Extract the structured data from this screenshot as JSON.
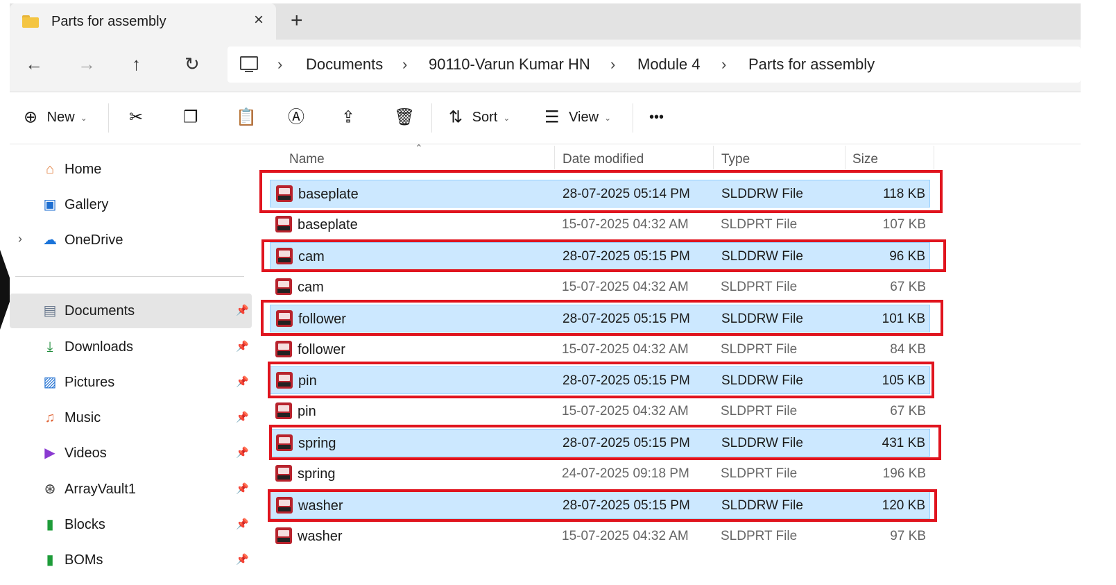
{
  "tab": {
    "title": "Parts for assembly",
    "close": "×",
    "new_tab": "+"
  },
  "nav": {
    "back": "←",
    "forward": "→",
    "up": "↑",
    "refresh": "↻",
    "breadcrumbs": [
      "Documents",
      "90110-Varun Kumar HN",
      "Module 4",
      "Parts for assembly"
    ],
    "separator": "›"
  },
  "toolbar": {
    "new_label": "New",
    "sort_label": "Sort",
    "view_label": "View",
    "more_label": "•••",
    "icons": [
      "cut-icon",
      "copy-icon",
      "paste-icon",
      "rename-icon",
      "share-icon",
      "delete-icon"
    ]
  },
  "sidebar": {
    "items": [
      {
        "label": "Home",
        "icon": "home-icon"
      },
      {
        "label": "Gallery",
        "icon": "gallery-icon"
      },
      {
        "label": "OneDrive",
        "icon": "cloud-icon"
      },
      {
        "label": "Documents",
        "icon": "documents-icon",
        "pinned": true,
        "active": true
      },
      {
        "label": "Downloads",
        "icon": "download-icon",
        "pinned": true
      },
      {
        "label": "Pictures",
        "icon": "pictures-icon",
        "pinned": true
      },
      {
        "label": "Music",
        "icon": "music-icon",
        "pinned": true
      },
      {
        "label": "Videos",
        "icon": "videos-icon",
        "pinned": true
      },
      {
        "label": "ArrayVault1",
        "icon": "network-icon",
        "pinned": true
      },
      {
        "label": "Blocks",
        "icon": "book-icon",
        "pinned": true
      },
      {
        "label": "BOMs",
        "icon": "book-icon",
        "pinned": true
      }
    ]
  },
  "columns": {
    "name": "Name",
    "date": "Date modified",
    "type": "Type",
    "size": "Size"
  },
  "files": [
    {
      "name": "baseplate",
      "date": "28-07-2025 05:14 PM",
      "type": "SLDDRW File",
      "size": "118 KB",
      "selected": true
    },
    {
      "name": "baseplate",
      "date": "15-07-2025 04:32 AM",
      "type": "SLDPRT File",
      "size": "107 KB",
      "selected": false
    },
    {
      "name": "cam",
      "date": "28-07-2025 05:15 PM",
      "type": "SLDDRW File",
      "size": "96 KB",
      "selected": true
    },
    {
      "name": "cam",
      "date": "15-07-2025 04:32 AM",
      "type": "SLDPRT File",
      "size": "67 KB",
      "selected": false
    },
    {
      "name": "follower",
      "date": "28-07-2025 05:15 PM",
      "type": "SLDDRW File",
      "size": "101 KB",
      "selected": true
    },
    {
      "name": "follower",
      "date": "15-07-2025 04:32 AM",
      "type": "SLDPRT File",
      "size": "84 KB",
      "selected": false
    },
    {
      "name": "pin",
      "date": "28-07-2025 05:15 PM",
      "type": "SLDDRW File",
      "size": "105 KB",
      "selected": true
    },
    {
      "name": "pin",
      "date": "15-07-2025 04:32 AM",
      "type": "SLDPRT File",
      "size": "67 KB",
      "selected": false
    },
    {
      "name": "spring",
      "date": "28-07-2025 05:15 PM",
      "type": "SLDDRW File",
      "size": "431 KB",
      "selected": true
    },
    {
      "name": "spring",
      "date": "24-07-2025 09:18 PM",
      "type": "SLDPRT File",
      "size": "196 KB",
      "selected": false
    },
    {
      "name": "washer",
      "date": "28-07-2025 05:15 PM",
      "type": "SLDDRW File",
      "size": "120 KB",
      "selected": true
    },
    {
      "name": "washer",
      "date": "15-07-2025 04:32 AM",
      "type": "SLDPRT File",
      "size": "97 KB",
      "selected": false
    }
  ],
  "colors": {
    "selection": "#cce8ff",
    "highlight_box": "#e0141e",
    "file_icon": "#b8232d"
  }
}
